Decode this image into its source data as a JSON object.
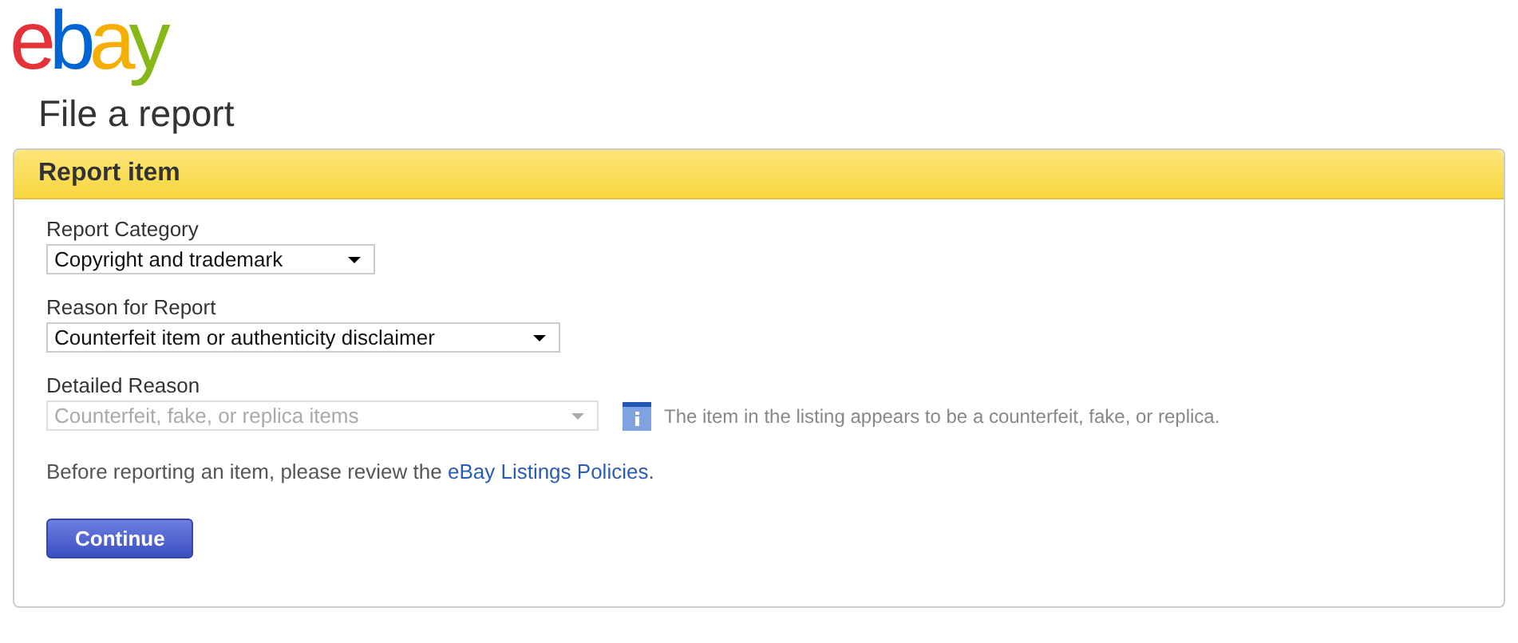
{
  "logo": {
    "text": "ebay"
  },
  "page_title": "File a report",
  "panel": {
    "title": "Report item",
    "fields": [
      {
        "label": "Report Category",
        "value": "Copyright and trademark",
        "disabled": false
      },
      {
        "label": "Reason for Report",
        "value": "Counterfeit item or authenticity disclaimer",
        "disabled": false
      },
      {
        "label": "Detailed Reason",
        "value": "Counterfeit, fake, or replica items",
        "disabled": true,
        "hint": "The item in the listing appears to be a counterfeit, fake, or replica."
      }
    ],
    "note": {
      "before": "Before reporting an item, please review the ",
      "link": "eBay Listings Policies",
      "after": "."
    },
    "button": "Continue"
  }
}
